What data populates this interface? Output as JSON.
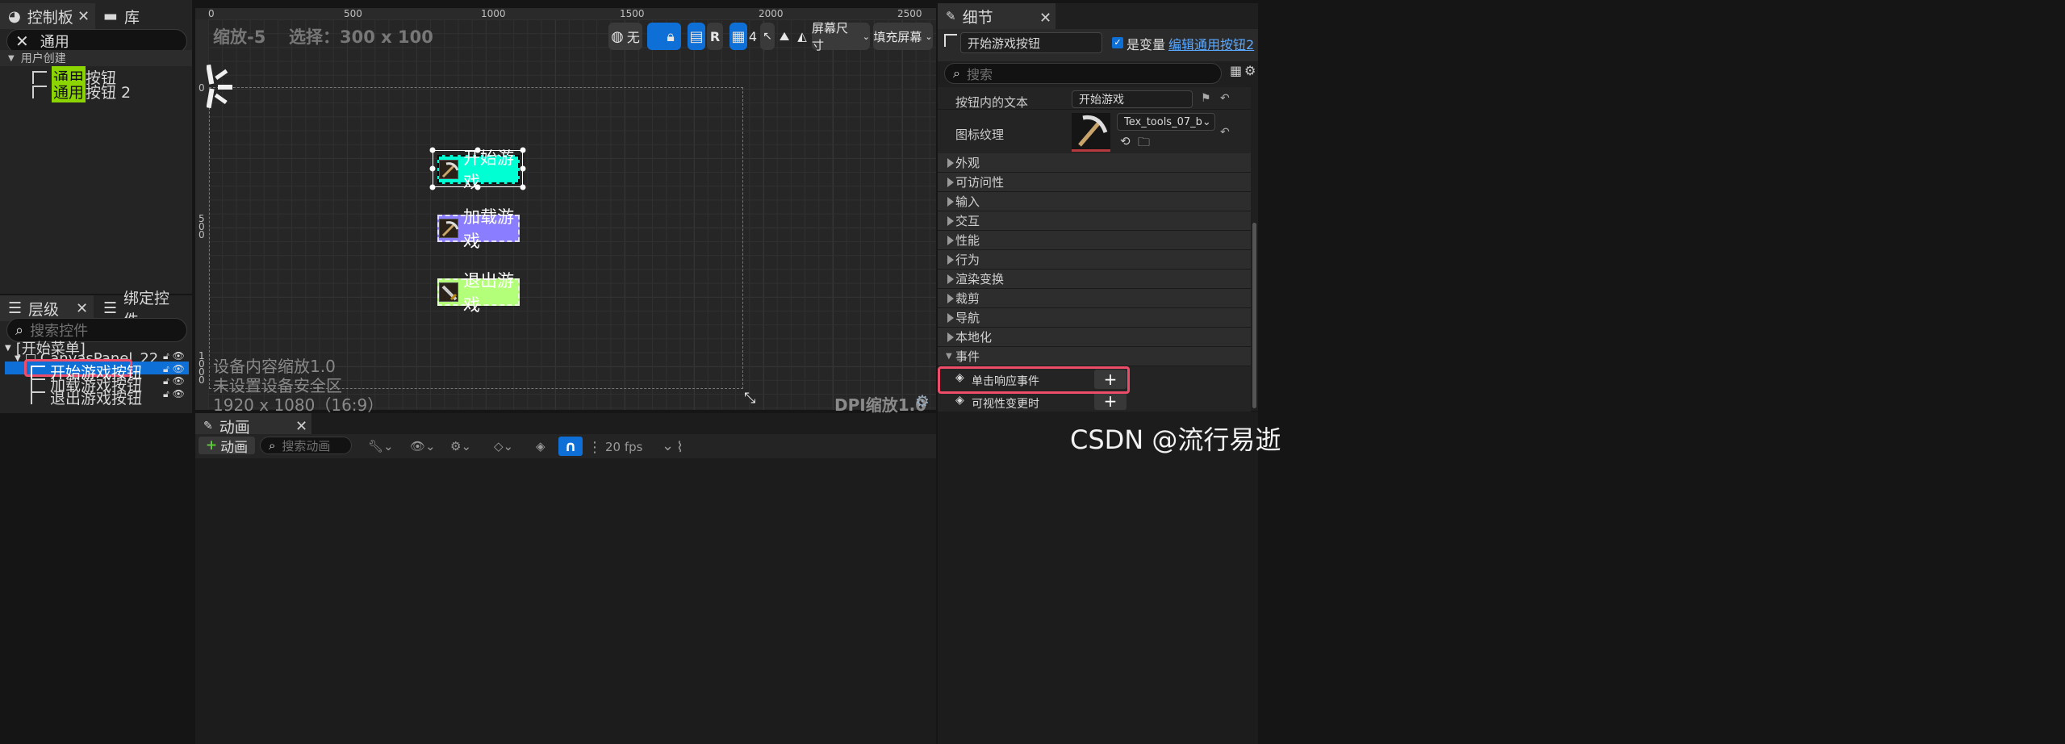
{
  "palette": {
    "tab_title": "控制板",
    "lib_tab": "库",
    "search_value": "通用",
    "category": "用户创建",
    "items": [
      {
        "hl": "通用",
        "rest": "按钮"
      },
      {
        "hl": "通用",
        "rest": "按钮 2"
      }
    ]
  },
  "hierarchy": {
    "tab_title": "层级",
    "bind_tab": "绑定控件",
    "search_placeholder": "搜索控件",
    "root": "[开始菜单]",
    "canvas": "CanvasPanel_22",
    "items": [
      "开始游戏按钮",
      "加载游戏按钮",
      "退出游戏按钮"
    ]
  },
  "viewport": {
    "zoom": "缩放-5",
    "selection": "选择：300 x 100",
    "btn_none": "无",
    "btn_r": "R",
    "grid_num": "4",
    "screen_size": "屏幕尺寸",
    "fill_screen": "填充屏幕",
    "ruler_top": [
      "0",
      "500",
      "1000",
      "1500",
      "2000",
      "2500"
    ],
    "ruler_left_0": "0",
    "ruler_left_500": "5\n0\n0",
    "ruler_left_1000": "1\n0\n0\n0",
    "buttons": [
      "开始游戏",
      "加载游戏",
      "退出游戏"
    ],
    "button_colors": [
      "#00ffd2",
      "#8a7dff",
      "#b4ff7a"
    ],
    "info1": "设备内容缩放1.0",
    "info2": "未设置设备安全区",
    "info3": "1920 x 1080（16:9）",
    "dpi": "DPI缩放1.0"
  },
  "animation": {
    "tab_title": "动画",
    "add_button": "动画",
    "search_placeholder": "搜索动画",
    "fps": "20 fps"
  },
  "details": {
    "tab_title": "细节",
    "name_value": "开始游戏按钮",
    "is_variable": "是变量",
    "edit_link": "编辑通用按钮2",
    "search_placeholder": "搜索",
    "btn_text_label": "按钮内的文本",
    "btn_text_value": "开始游戏",
    "icon_label": "图标纹理",
    "texture_name": "Tex_tools_07_b",
    "sections": [
      "外观",
      "可访问性",
      "输入",
      "交互",
      "性能",
      "行为",
      "渲染变换",
      "裁剪",
      "导航",
      "本地化",
      "事件"
    ],
    "events": [
      "单击响应事件",
      "可视性变更时"
    ]
  },
  "watermark": "CSDN @流行易逝"
}
